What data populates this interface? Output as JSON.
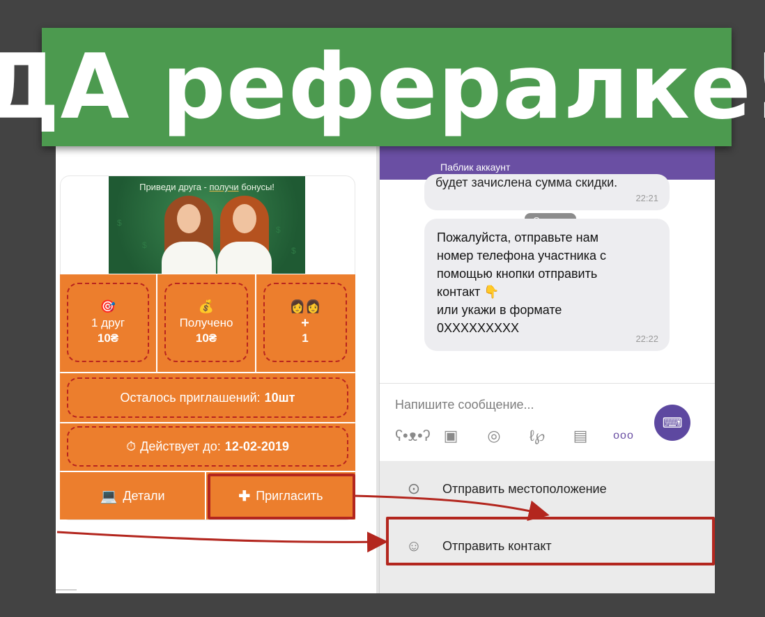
{
  "title": "ДА рефералке!",
  "left": {
    "promo_text_pre": "Приведи друга - ",
    "promo_text_link": "получи",
    "promo_text_post": " бонусы!",
    "stats": [
      {
        "icon": "🎯",
        "label": "1 друг",
        "value": "10₴"
      },
      {
        "icon": "💰",
        "label": "Получено",
        "value": "10₴"
      },
      {
        "icon": "👩‍👩",
        "label": "+",
        "value": "1"
      }
    ],
    "remaining_label": "Осталось приглашений:",
    "remaining_value": "10шт",
    "valid_label": "Действует до:",
    "valid_value": "12-02-2019",
    "valid_icon": "⏱",
    "details_label": "Детали",
    "details_icon": "💻",
    "invite_label": "Пригласить",
    "invite_icon": "✚"
  },
  "right": {
    "header_subtitle": "Паблик аккаунт",
    "partial_text": "будет зачислена сумма скидки.",
    "today_label": "Сегодня",
    "msg1_time": "22:21",
    "msg2_lines": [
      "Пожалуйста, отправьте нам",
      "номер телефона участника с",
      "помощью кнопки отправить",
      "контакт 👇",
      "или укажи в формате",
      "0XXXXXXXXX"
    ],
    "msg2_time": "22:22",
    "composer_placeholder": "Напишите сообщение...",
    "composer_more": "ooo",
    "menu_location": "Отправить местоположение",
    "menu_contact": "Отправить контакт"
  },
  "colors": {
    "banner": "#4c9a4f",
    "accent_orange": "#ec7e2d",
    "highlight_red": "#b3261e",
    "viber_purple": "#6a4fa3"
  }
}
